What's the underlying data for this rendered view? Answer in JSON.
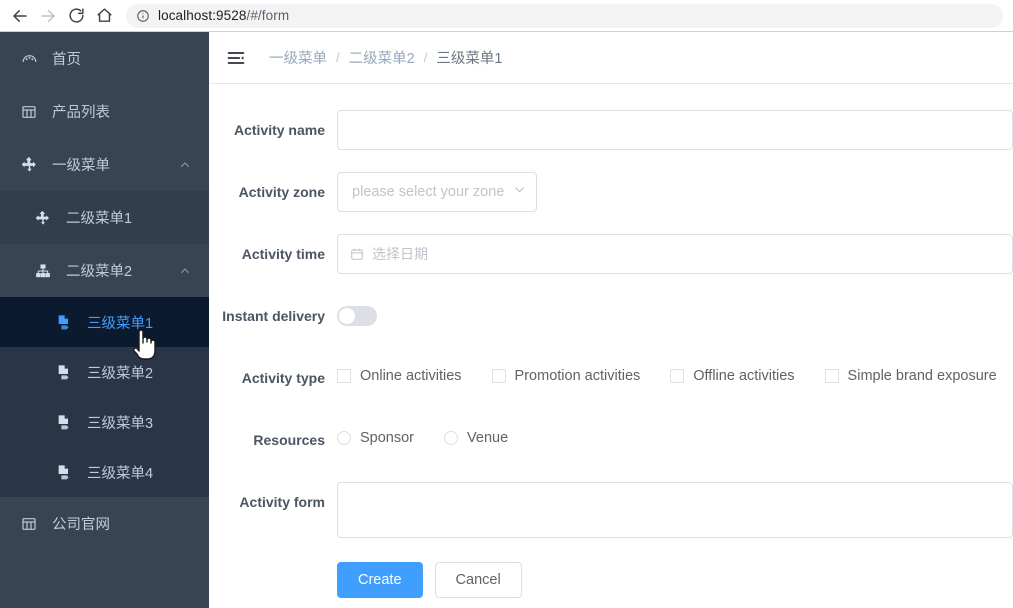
{
  "browser": {
    "back_icon": "arrow-left-icon",
    "forward_icon": "arrow-right-icon",
    "reload_icon": "reload-icon",
    "home_icon": "home-icon",
    "site_info_icon": "info-circle-icon",
    "url_host": "localhost:9528",
    "url_path": "/#/form",
    "url_full": "localhost:9528/#/form"
  },
  "sidebar": {
    "items": [
      {
        "label": "首页",
        "icon": "dashboard-icon",
        "level": 1,
        "active": false,
        "expandable": false
      },
      {
        "label": "产品列表",
        "icon": "table-icon",
        "level": 1,
        "active": false,
        "expandable": false
      },
      {
        "label": "一级菜单",
        "icon": "component-icon",
        "level": 1,
        "active": false,
        "expandable": true,
        "expanded": true
      },
      {
        "label": "二级菜单1",
        "icon": "component-icon",
        "level": 2,
        "active": false,
        "expandable": false
      },
      {
        "label": "二级菜单2",
        "icon": "tree-icon",
        "level": 2,
        "active": false,
        "expandable": true,
        "expanded": true
      },
      {
        "label": "三级菜单1",
        "icon": "document-icon",
        "level": 3,
        "active": true,
        "expandable": false
      },
      {
        "label": "三级菜单2",
        "icon": "document-icon",
        "level": 3,
        "active": false,
        "expandable": false
      },
      {
        "label": "三级菜单3",
        "icon": "document-icon",
        "level": 3,
        "active": false,
        "expandable": false
      },
      {
        "label": "三级菜单4",
        "icon": "document-icon",
        "level": 3,
        "active": false,
        "expandable": false
      },
      {
        "label": "公司官网",
        "icon": "table-icon",
        "level": 1,
        "active": false,
        "expandable": false
      }
    ]
  },
  "navbar": {
    "hamburger_icon": "hamburger-collapse-icon",
    "breadcrumb": [
      "一级菜单",
      "二级菜单2",
      "三级菜单1"
    ],
    "breadcrumb_separator": "/"
  },
  "form": {
    "activity_name": {
      "label": "Activity name",
      "value": ""
    },
    "activity_zone": {
      "label": "Activity zone",
      "placeholder": "please select your zone",
      "value": "",
      "chevron_icon": "chevron-down-icon"
    },
    "activity_time": {
      "label": "Activity time",
      "placeholder": "选择日期",
      "value": "",
      "icon": "calendar-icon"
    },
    "instant_delivery": {
      "label": "Instant delivery",
      "checked": false
    },
    "activity_type": {
      "label": "Activity type",
      "options": [
        {
          "label": "Online activities",
          "checked": false
        },
        {
          "label": "Promotion activities",
          "checked": false
        },
        {
          "label": "Offline activities",
          "checked": false
        },
        {
          "label": "Simple brand exposure",
          "checked": false
        }
      ]
    },
    "resources": {
      "label": "Resources",
      "options": [
        {
          "label": "Sponsor",
          "selected": false
        },
        {
          "label": "Venue",
          "selected": false
        }
      ]
    },
    "activity_form": {
      "label": "Activity form",
      "value": ""
    },
    "buttons": {
      "create": "Create",
      "cancel": "Cancel"
    }
  },
  "colors": {
    "sidebar_bg": "#394453",
    "sidebar_submenu_bg": "#2e3849",
    "active_item_bg": "#0b1a2e",
    "accent_blue": "#409eff",
    "label_text": "#4b5563"
  }
}
